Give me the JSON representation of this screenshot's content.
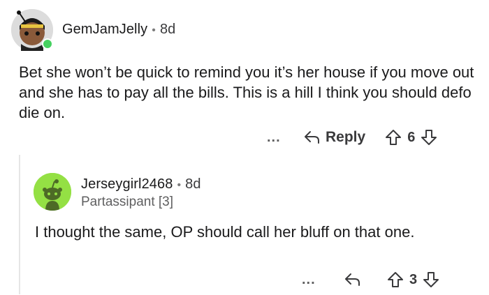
{
  "comments": [
    {
      "author": "GemJamJelly",
      "age": "8d",
      "body": "Bet she won’t be quick to remind you it’s her house if you move out and she has to pay all the bills. This is a hill I think you should defo die on.",
      "actions": {
        "more": "...",
        "reply": "Reply",
        "votes": "6"
      }
    },
    {
      "author": "Jerseygirl2468",
      "age": "8d",
      "flair": "Partassipant [3]",
      "body": "I thought the same, OP should call her bluff on that one.",
      "actions": {
        "more": "...",
        "votes": "3"
      }
    }
  ],
  "separator": "•",
  "colors": {
    "online": "#46d160",
    "avatar2_bg": "#94e044",
    "text": "#1a1a1b",
    "muted": "#7c7c7c"
  },
  "icons": [
    "avatar-icon",
    "online-indicator-icon",
    "reply-arrow-icon",
    "upvote-icon",
    "downvote-icon",
    "snoo-avatar-icon"
  ]
}
